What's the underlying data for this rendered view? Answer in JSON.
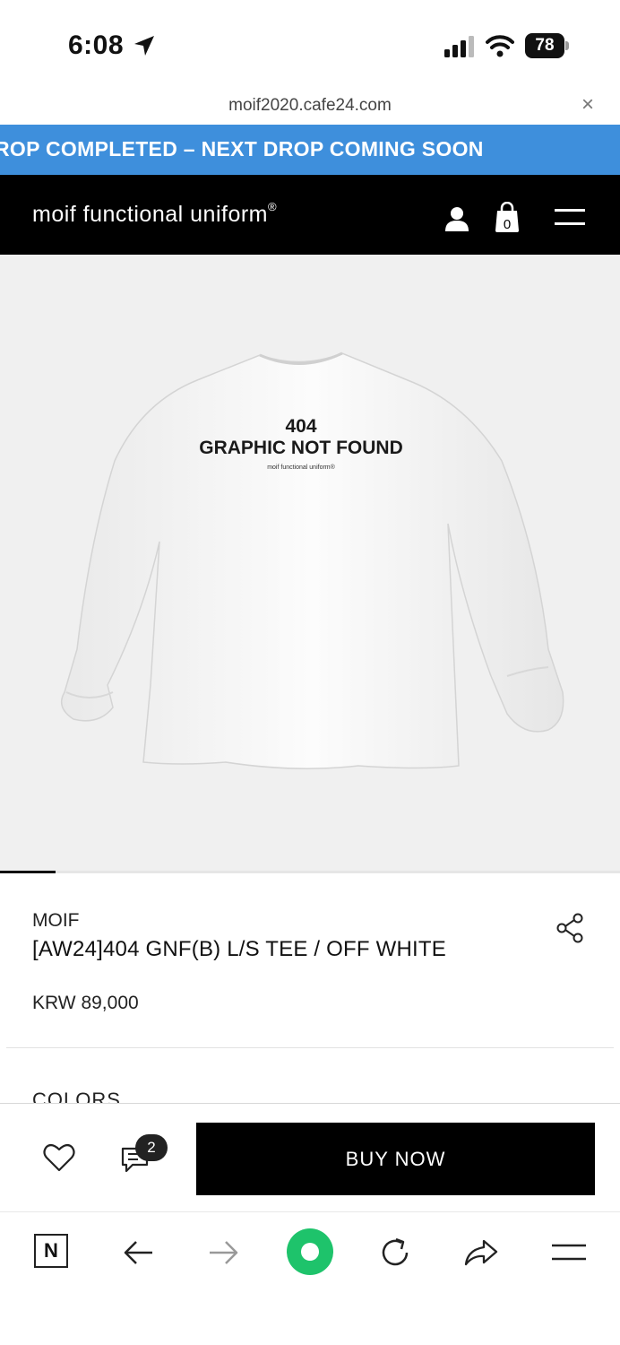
{
  "status_bar": {
    "time": "6:08",
    "battery": "78"
  },
  "browser": {
    "url": "moif2020.cafe24.com"
  },
  "banner": {
    "text": "ROP COMPLETED – NEXT DROP COMING SOON",
    "color": "#3e8fdc"
  },
  "header": {
    "logo": "moif functional uniform",
    "logo_mark": "®",
    "cart_count": "0"
  },
  "product_image": {
    "print_line1": "404",
    "print_line2": "GRAPHIC NOT FOUND",
    "print_line3": "moif functional uniform®",
    "gallery_progress": 0.09
  },
  "product": {
    "brand": "MOIF",
    "name": "[AW24]404 GNF(B) L/S TEE / OFF WHITE",
    "price": "KRW 89,000",
    "colors_label": "COLORS"
  },
  "actions": {
    "review_count": "2",
    "buy_label": "BUY NOW"
  },
  "toolbar": {
    "home_label": "N",
    "accent": "#1ec36b"
  }
}
